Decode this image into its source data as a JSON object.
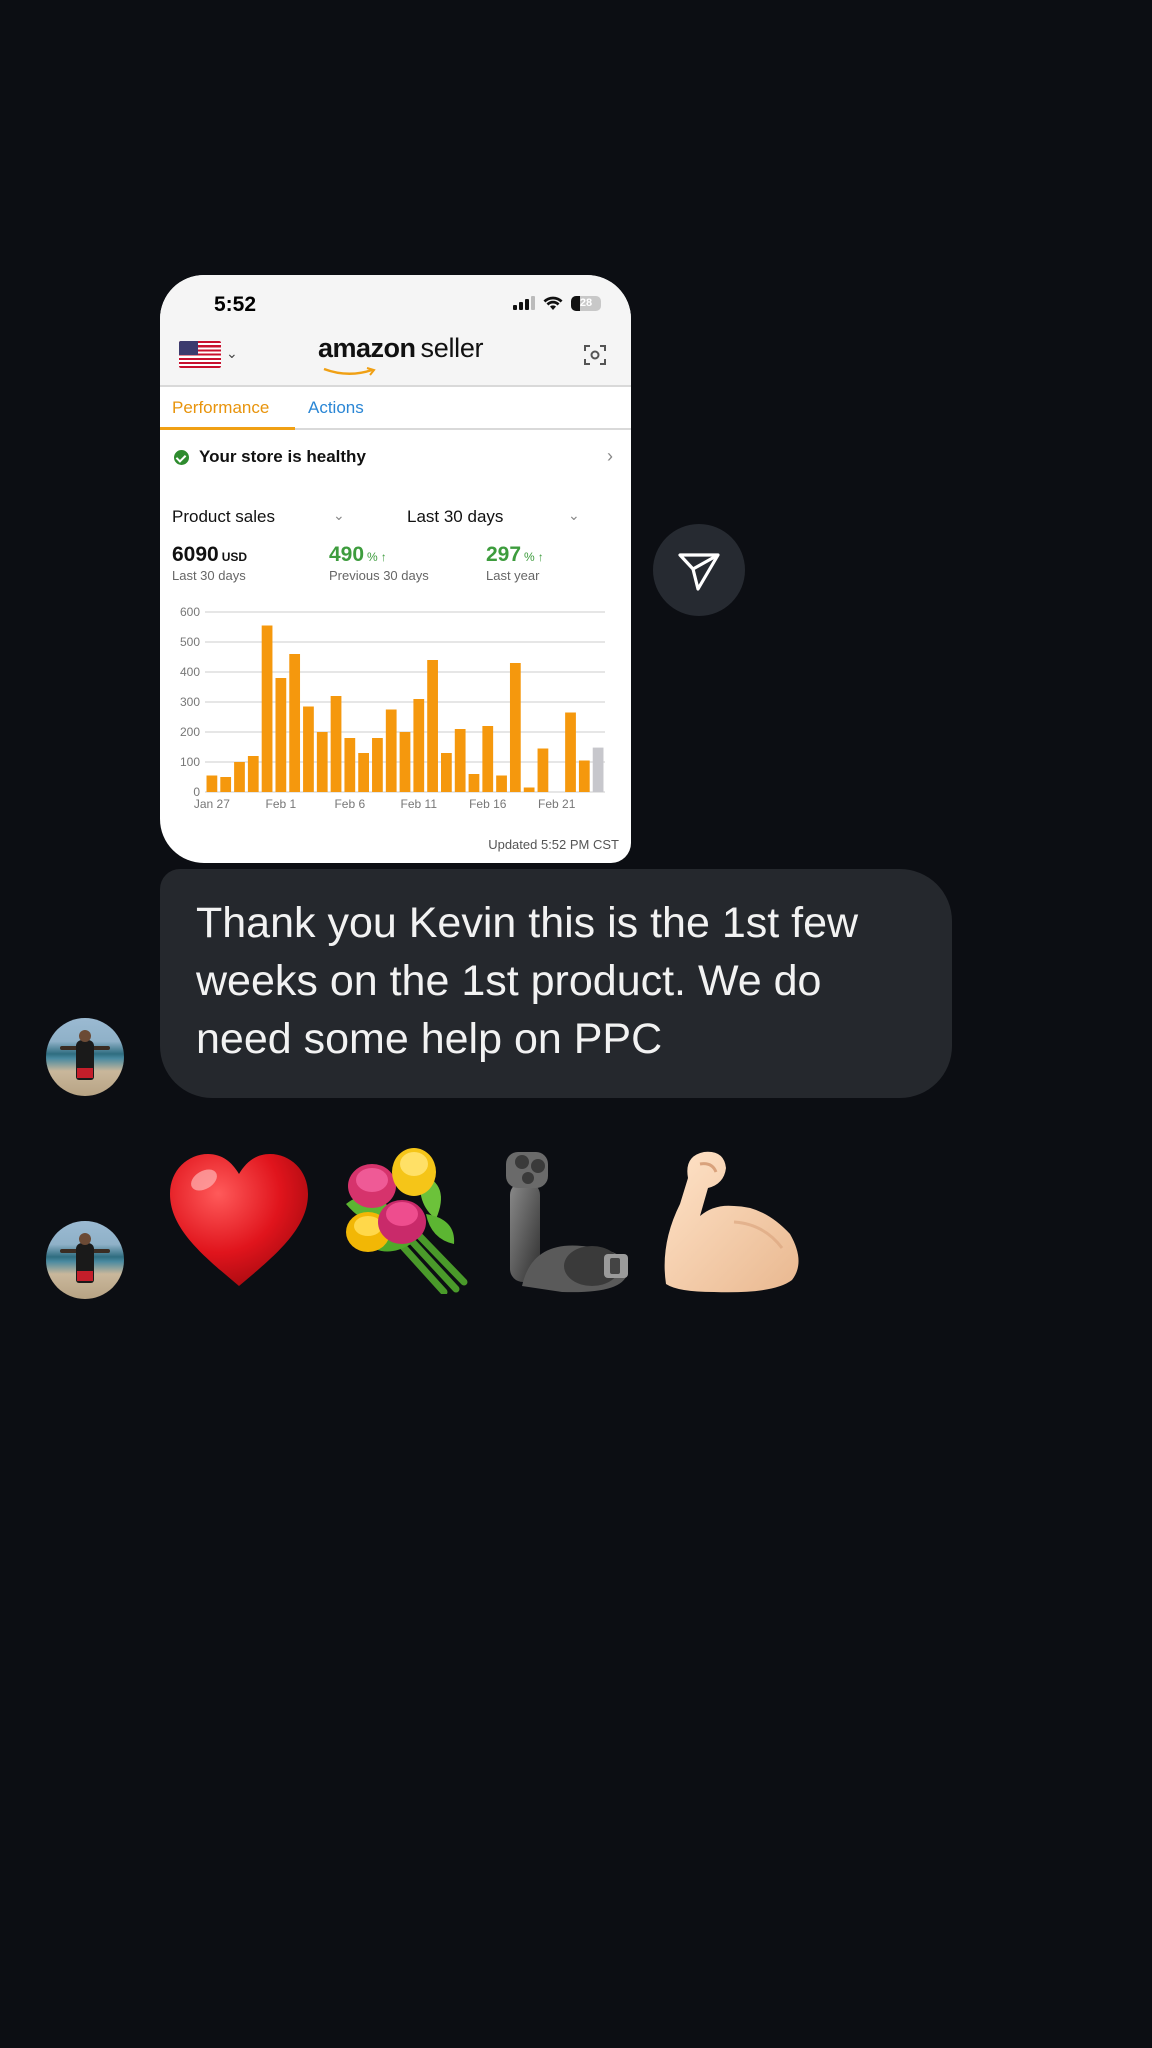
{
  "screenshot": {
    "status_time": "5:52",
    "battery": "28",
    "brand_amazon": "amazon",
    "brand_seller": "seller",
    "tabs": {
      "performance": "Performance",
      "actions": "Actions"
    },
    "health": "Your store is healthy",
    "selectors": {
      "metric": "Product sales",
      "range": "Last 30 days"
    },
    "metrics": {
      "sales_value": "6090",
      "sales_unit": "USD",
      "sales_sub": "Last 30 days",
      "prev_value": "490",
      "prev_unit": "%",
      "prev_sub": "Previous 30 days",
      "year_value": "297",
      "year_unit": "%",
      "year_sub": "Last year"
    },
    "updated": "Updated 5:52 PM CST",
    "colors": {
      "bar": "#f5980d",
      "bar_today": "#c7c7cc",
      "accent_orange": "#e8940c",
      "accent_blue": "#2a86d5",
      "positive": "#3d9c3d"
    }
  },
  "chart_data": {
    "type": "bar",
    "ylim": [
      0,
      600
    ],
    "yticks": [
      "0",
      "100",
      "200",
      "300",
      "400",
      "500",
      "600"
    ],
    "xticks": [
      "Jan 27",
      "Feb 1",
      "Feb 6",
      "Feb 11",
      "Feb 16",
      "Feb 21"
    ],
    "values": [
      55,
      50,
      100,
      120,
      555,
      380,
      460,
      285,
      200,
      320,
      180,
      130,
      180,
      275,
      200,
      310,
      440,
      130,
      210,
      60,
      220,
      55,
      430,
      15,
      145,
      0,
      265,
      105,
      148
    ],
    "grid": true
  },
  "message": {
    "text": "Thank you Kevin this is the 1st few weeks on the 1st product. We do need some help on PPC"
  },
  "reactions": [
    "red-heart",
    "bouquet",
    "mechanical-arm",
    "flexed-biceps"
  ]
}
